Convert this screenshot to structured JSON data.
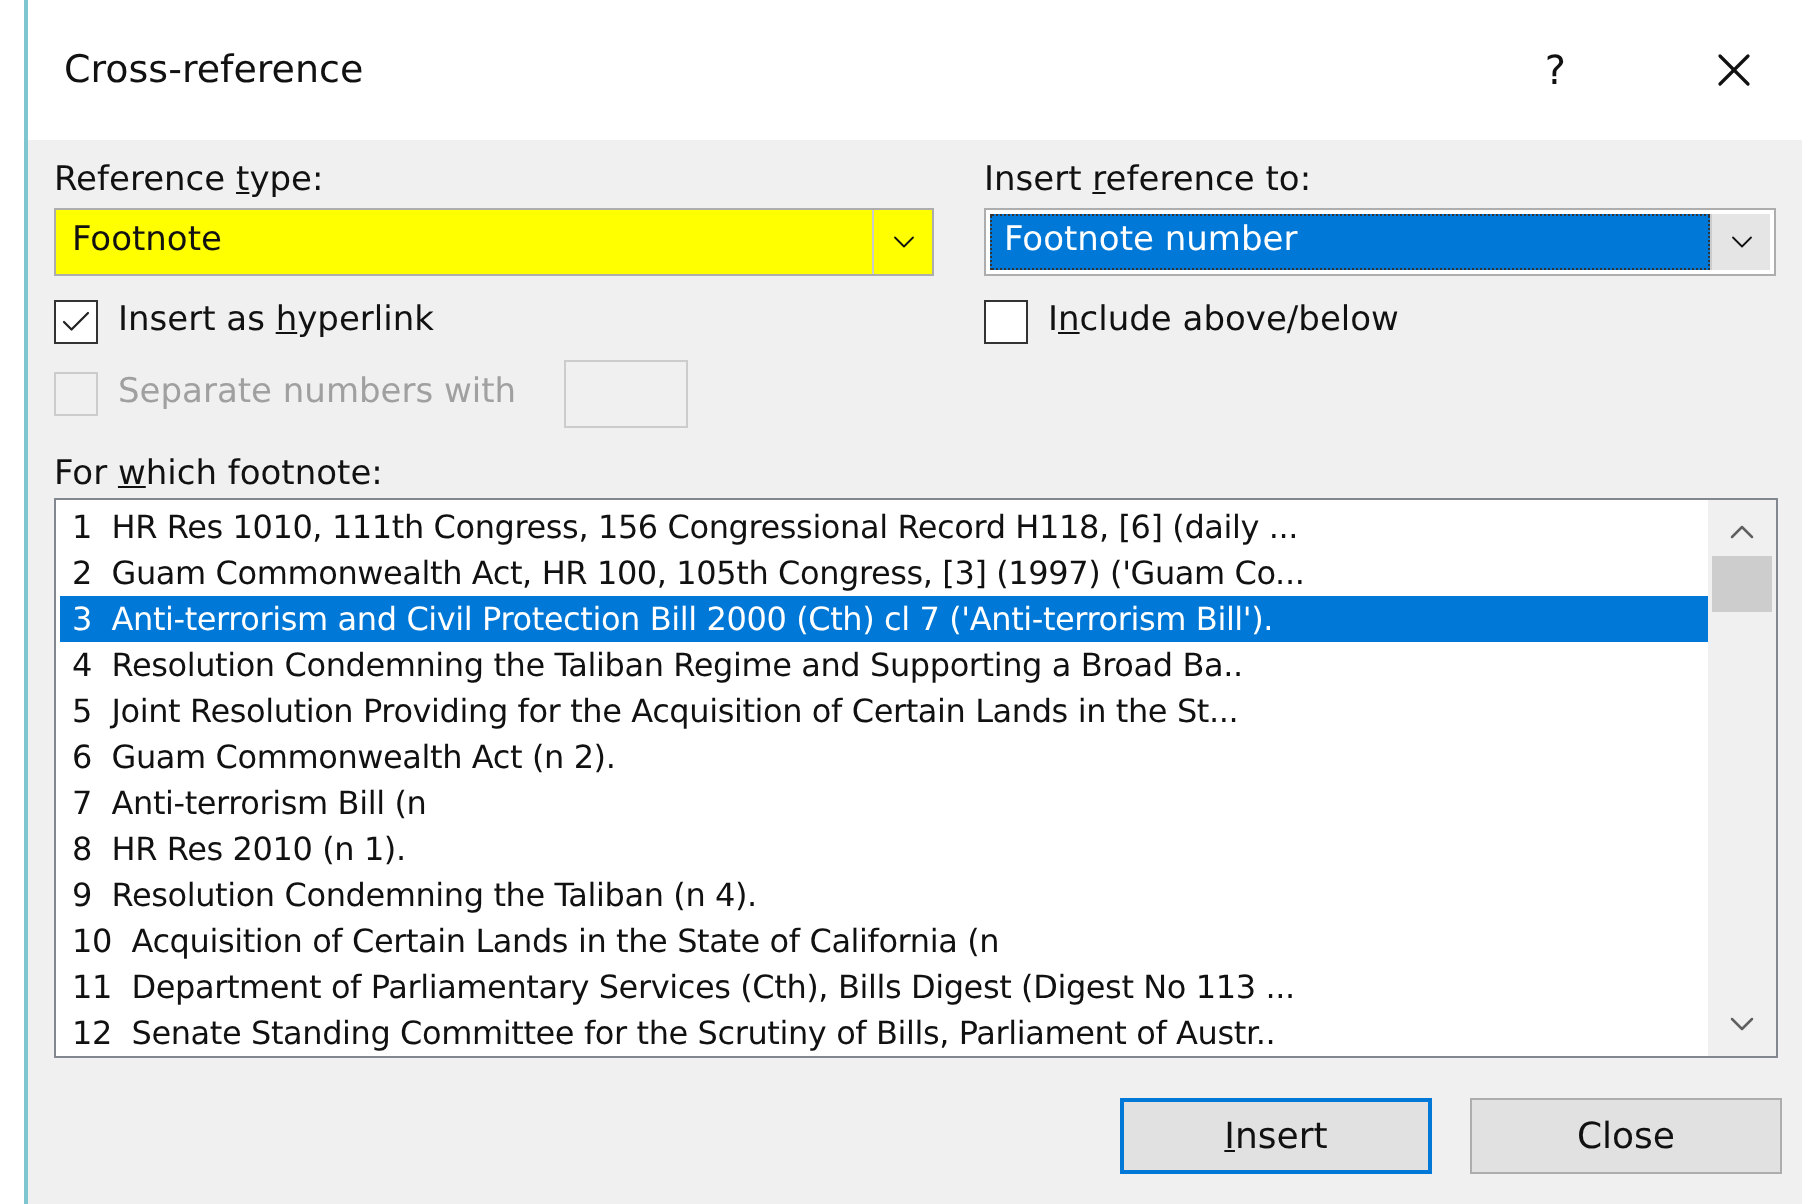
{
  "window": {
    "title": "Cross-reference",
    "help": "?"
  },
  "reference_type": {
    "label_parts": {
      "pre": "Reference ",
      "key": "t",
      "post": "ype:"
    },
    "value": "Footnote",
    "highlighted": true
  },
  "insert_reference_to": {
    "label_parts": {
      "pre": "Insert ",
      "key": "r",
      "post": "eference to:"
    },
    "value": "Footnote number",
    "selected": true
  },
  "checkboxes": [
    {
      "label_parts": {
        "pre": "Insert as ",
        "key": "h",
        "post": "yperlink"
      },
      "checked": true,
      "disabled": false
    },
    {
      "label_parts": {
        "pre": "I",
        "key": "n",
        "post": "clude above/below"
      },
      "checked": false,
      "disabled": false
    },
    {
      "label_parts": {
        "pre": "Separate numbers with"
      },
      "checked": false,
      "disabled": true
    }
  ],
  "list": {
    "label_parts": {
      "pre": "For ",
      "key": "w",
      "post": "hich footnote:"
    },
    "items": [
      {
        "number": "1",
        "text": "HR Res 1010, 111th Congress, 156 Congressional Record H118, [6] (daily ...",
        "selected": false
      },
      {
        "number": "2",
        "text": "Guam Commonwealth Act, HR 100, 105th Congress, [3] (1997) ('Guam Co...",
        "selected": false
      },
      {
        "number": "3",
        "text": "Anti-terrorism and Civil Protection Bill 2000 (Cth) cl 7 ('Anti-terrorism Bill').",
        "selected": true
      },
      {
        "number": "4",
        "text": "Resolution Condemning the Taliban Regime and Supporting a Broad Ba..",
        "selected": false
      },
      {
        "number": "5",
        "text": "Joint Resolution Providing for the Acquisition of Certain Lands in the St...",
        "selected": false
      },
      {
        "number": "6",
        "text": "Guam Commonwealth Act (n 2).",
        "selected": false
      },
      {
        "number": "7",
        "text": "Anti-terrorism Bill (n",
        "selected": false
      },
      {
        "number": "8",
        "text": "HR Res 2010 (n 1).",
        "selected": false
      },
      {
        "number": "9",
        "text": "Resolution Condemning the Taliban (n 4).",
        "selected": false
      },
      {
        "number": "10",
        "text": "Acquisition of Certain Lands in the State of California (n",
        "selected": false
      },
      {
        "number": "11",
        "text": "Department of Parliamentary Services (Cth), Bills Digest (Digest No 113 ...",
        "selected": false
      },
      {
        "number": "12",
        "text": "Senate Standing Committee for the Scrutiny of Bills, Parliament of Austr..",
        "selected": false
      }
    ]
  },
  "buttons": [
    {
      "label_parts": {
        "key": "I",
        "post": "nsert"
      },
      "default": true
    },
    {
      "label_parts": {
        "pre": "Close"
      },
      "default": false
    }
  ]
}
